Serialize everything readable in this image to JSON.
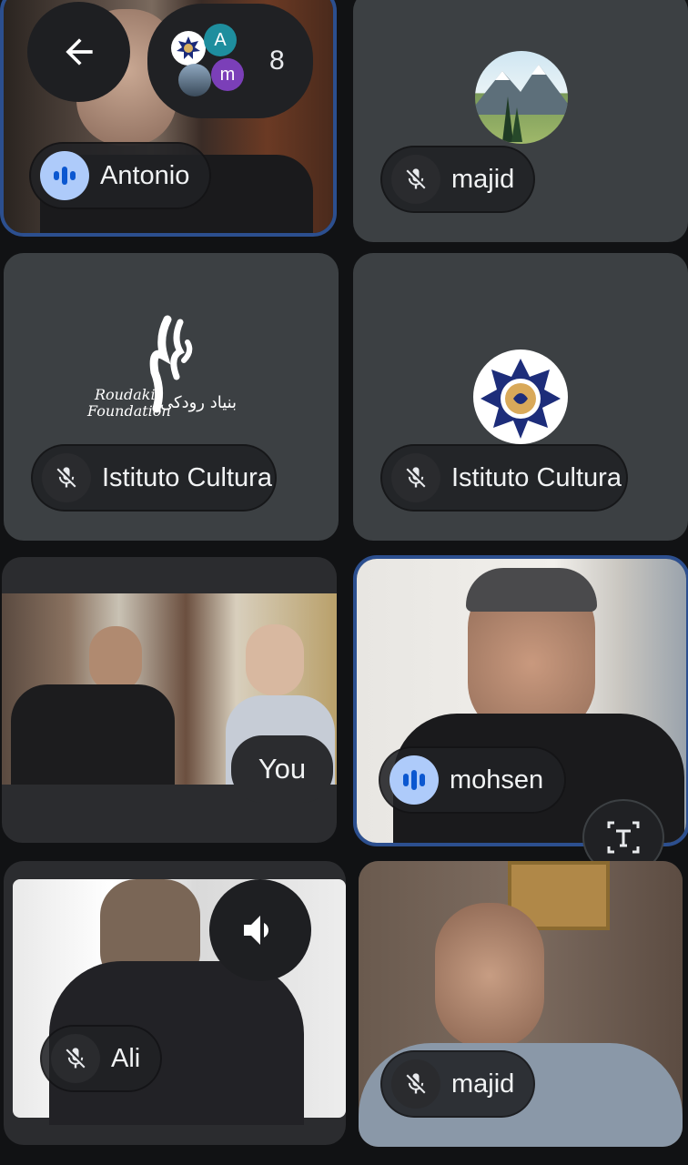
{
  "header": {
    "back_icon": "arrow-left-icon",
    "participant_count": "8",
    "mini_avatars": [
      {
        "letter": "",
        "color": "#ffffff",
        "icon": "emblem-icon"
      },
      {
        "letter": "A",
        "color": "#1e8e9e"
      },
      {
        "letter": "",
        "color": "#5f7fa0",
        "icon": "photo-avatar-icon"
      },
      {
        "letter": "m",
        "color": "#7b3fb8"
      }
    ]
  },
  "tiles": [
    {
      "name": "Antonio",
      "state": "speaking",
      "active": true
    },
    {
      "name": "majid",
      "state": "muted",
      "avatar": "mountain-landscape"
    },
    {
      "name": "Istituto Cultura",
      "state": "muted",
      "logo": "roudaki-foundation-logo"
    },
    {
      "name": "Istituto Cultura",
      "state": "muted",
      "logo": "institute-emblem"
    },
    {
      "name": "You",
      "state": "self"
    },
    {
      "name": "mohsen",
      "state": "speaking",
      "active": true
    },
    {
      "name": "Ali",
      "state": "muted"
    },
    {
      "name": "majid",
      "state": "muted"
    }
  ],
  "logo_text": {
    "latin_1": "Roudaki",
    "latin_2": "Foundation",
    "persian": "بنیاد رودکی"
  },
  "colors": {
    "tile_bg": "#3c4043",
    "active_border": "#2c4f8f",
    "speaking_accent": "#aecbfa",
    "background": "#111214"
  }
}
